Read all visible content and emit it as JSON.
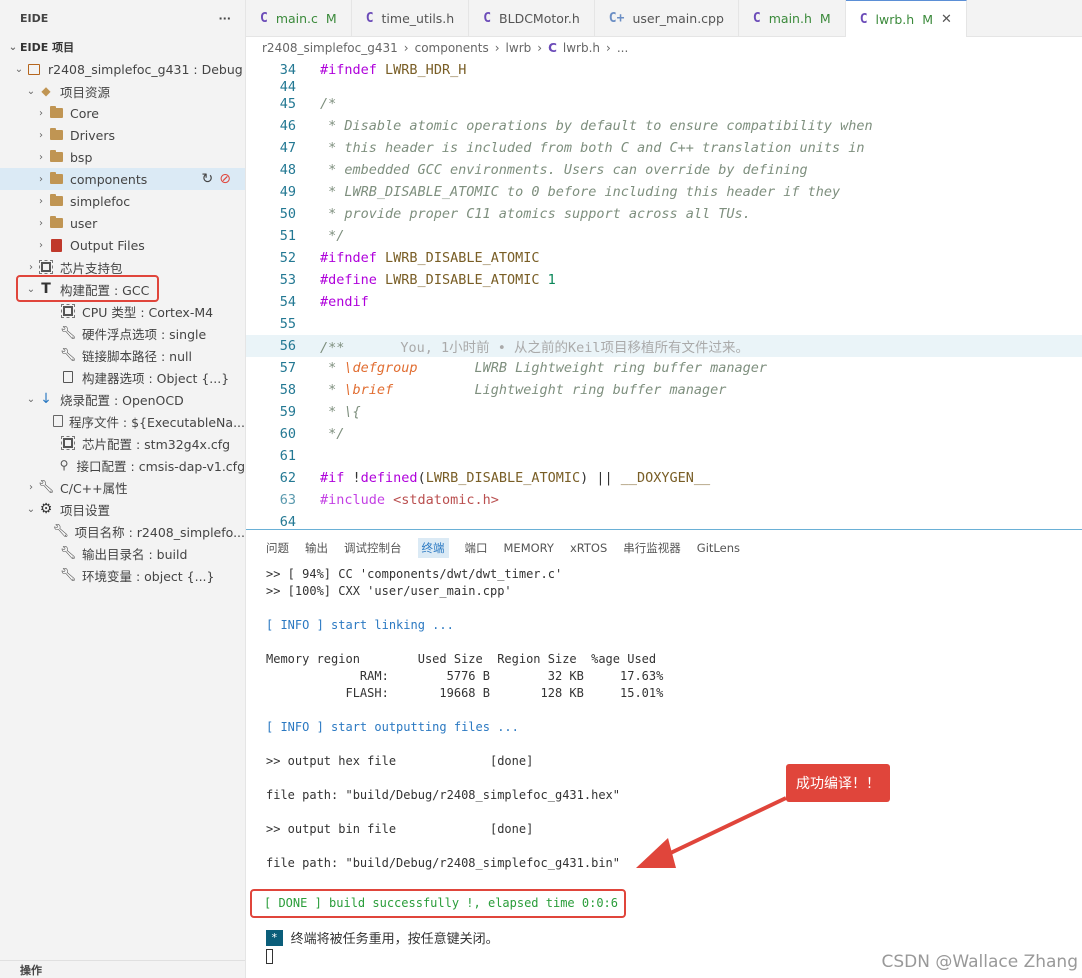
{
  "sidebar": {
    "title": "EIDE",
    "more": "···",
    "section": "EIDE 项目",
    "footer": "操作",
    "items": [
      {
        "label": "r2408_simplefoc_g431 : Debug"
      },
      {
        "label": "项目资源"
      },
      {
        "label": "Core"
      },
      {
        "label": "Drivers"
      },
      {
        "label": "bsp"
      },
      {
        "label": "components"
      },
      {
        "label": "simplefoc"
      },
      {
        "label": "user"
      },
      {
        "label": "Output Files"
      },
      {
        "label": "芯片支持包"
      },
      {
        "label": "构建配置 : GCC"
      },
      {
        "label": "CPU 类型 : Cortex-M4"
      },
      {
        "label": "硬件浮点选项 : single"
      },
      {
        "label": "链接脚本路径 : null"
      },
      {
        "label": "构建器选项 : Object {...}"
      },
      {
        "label": "烧录配置 : OpenOCD"
      },
      {
        "label": "程序文件 : ${ExecutableNa..."
      },
      {
        "label": "芯片配置 : stm32g4x.cfg"
      },
      {
        "label": "接口配置 : cmsis-dap-v1.cfg"
      },
      {
        "label": "C/C++属性"
      },
      {
        "label": "项目设置"
      },
      {
        "label": "项目名称 : r2408_simplefo..."
      },
      {
        "label": "输出目录名 : build"
      },
      {
        "label": "环境变量 : object {...}"
      }
    ]
  },
  "tabs": [
    {
      "icon": "C",
      "label": "main.c",
      "mod": "M"
    },
    {
      "icon": "C",
      "label": "time_utils.h",
      "mod": ""
    },
    {
      "icon": "C",
      "label": "BLDCMotor.h",
      "mod": ""
    },
    {
      "icon": "C+",
      "label": "user_main.cpp",
      "mod": ""
    },
    {
      "icon": "C",
      "label": "main.h",
      "mod": "M"
    },
    {
      "icon": "C",
      "label": "lwrb.h",
      "mod": "M"
    }
  ],
  "breadcrumb": {
    "p1": "r2408_simplefoc_g431",
    "p2": "components",
    "p3": "lwrb",
    "icon": "C",
    "p4": "lwrb.h",
    "p5": "..."
  },
  "editor": {
    "lines": [
      {
        "n": "34",
        "t": "#ifndef LWRB_HDR_H"
      },
      {
        "n": "44",
        "t": ""
      },
      {
        "n": "45",
        "t": "/*"
      },
      {
        "n": "46",
        "t": " * Disable atomic operations by default to ensure compatibility when"
      },
      {
        "n": "47",
        "t": " * this header is included from both C and C++ translation units in"
      },
      {
        "n": "48",
        "t": " * embedded GCC environments. Users can override by defining"
      },
      {
        "n": "49",
        "t": " * LWRB_DISABLE_ATOMIC to 0 before including this header if they"
      },
      {
        "n": "50",
        "t": " * provide proper C11 atomics support across all TUs."
      },
      {
        "n": "51",
        "t": " */"
      },
      {
        "n": "52",
        "t": "#ifndef LWRB_DISABLE_ATOMIC"
      },
      {
        "n": "53",
        "t": "#define LWRB_DISABLE_ATOMIC 1"
      },
      {
        "n": "54",
        "t": "#endif"
      },
      {
        "n": "55",
        "t": ""
      },
      {
        "n": "56",
        "t": "/**"
      },
      {
        "n": "57",
        "t": " * \\defgroup       LWRB Lightweight ring buffer manager"
      },
      {
        "n": "58",
        "t": " * \\brief          Lightweight ring buffer manager"
      },
      {
        "n": "59",
        "t": " * \\{"
      },
      {
        "n": "60",
        "t": " */"
      },
      {
        "n": "61",
        "t": ""
      },
      {
        "n": "62",
        "t": "#if !defined(LWRB_DISABLE_ATOMIC) || __DOXYGEN__"
      },
      {
        "n": "63",
        "t": "#include <stdatomic.h>"
      },
      {
        "n": "64",
        "t": ""
      }
    ],
    "blame": "You, 1小时前 • 从之前的Keil项目移植所有文件过来。"
  },
  "panel": {
    "tabs": [
      "问题",
      "输出",
      "调试控制台",
      "终端",
      "端口",
      "MEMORY",
      "xRTOS",
      "串行监视器",
      "GitLens"
    ],
    "terminal": [
      ">> [ 94%] CC 'components/dwt/dwt_timer.c'",
      ">> [100%] CXX 'user/user_main.cpp'",
      "",
      "[ INFO ] start linking ...",
      "",
      "Memory region        Used Size  Region Size  %age Used",
      "             RAM:        5776 B        32 KB     17.63%",
      "           FLASH:       19668 B       128 KB     15.01%",
      "",
      "[ INFO ] start outputting files ...",
      "",
      ">> output hex file             [done]",
      "",
      "file path: \"build/Debug/r2408_simplefoc_g431.hex\"",
      "",
      ">> output bin file             [done]",
      "",
      "file path: \"build/Debug/r2408_simplefoc_g431.bin\"",
      "",
      "[ DONE ] build successfully !, elapsed time 0:0:6"
    ],
    "close_star": "*",
    "close_msg": "终端将被任务重用，按任意键关闭。"
  },
  "annotation": {
    "callout": "成功编译！！",
    "color": "#e0453b"
  },
  "watermark": "CSDN @Wallace Zhang"
}
